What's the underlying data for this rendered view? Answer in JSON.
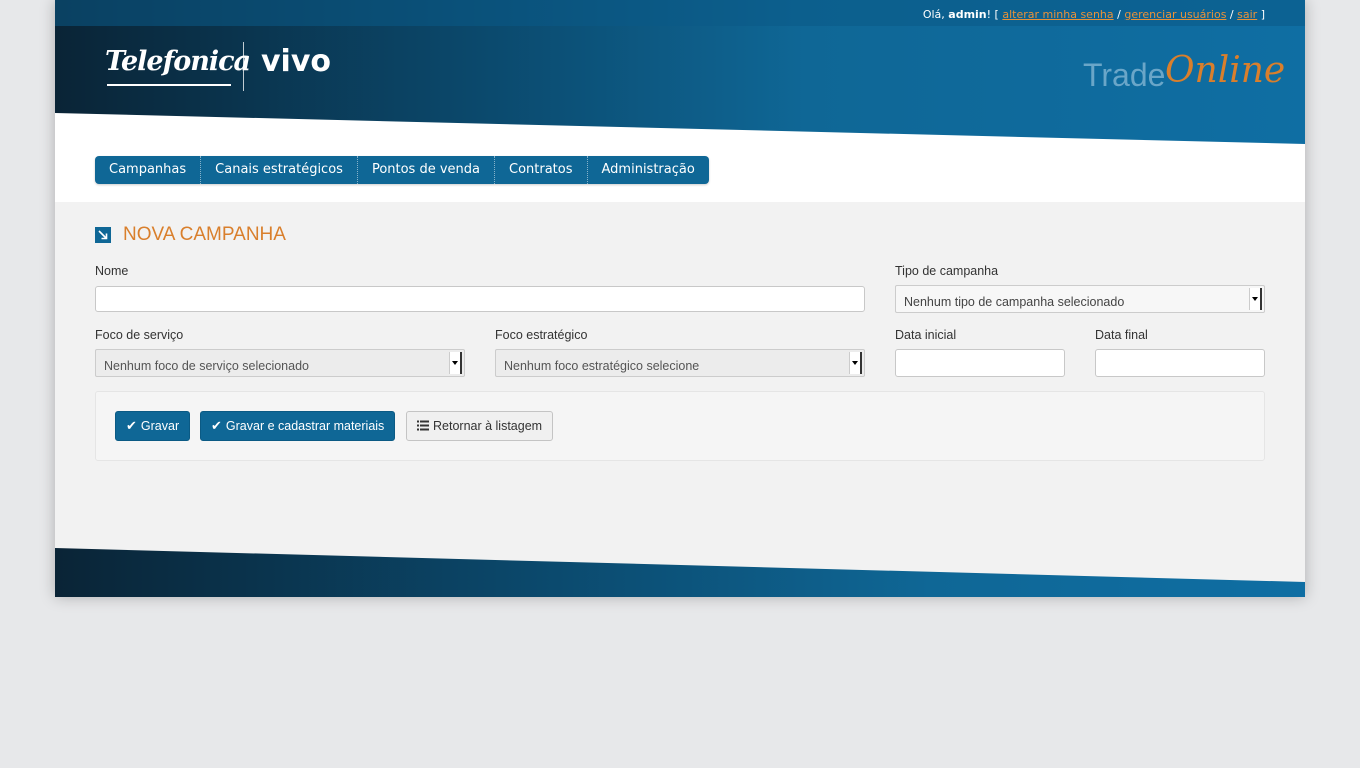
{
  "topbar": {
    "greeting": "Olá, ",
    "user": "admin",
    "exclaim": "! [ ",
    "link_password": "alterar minha senha",
    "sep1": " / ",
    "link_users": "gerenciar usuários",
    "sep2": " / ",
    "link_logout": "sair",
    "close": " ]"
  },
  "logos": {
    "telefonica": "Telefonica",
    "vivo": "vivo",
    "trade": "Trade",
    "online": "Online"
  },
  "nav": {
    "items": [
      {
        "label": "Campanhas"
      },
      {
        "label": "Canais estratégicos"
      },
      {
        "label": "Pontos de venda"
      },
      {
        "label": "Contratos"
      },
      {
        "label": "Administração"
      }
    ]
  },
  "form": {
    "title": "NOVA CAMPANHA",
    "nome_label": "Nome",
    "nome_value": "",
    "tipo_label": "Tipo de campanha",
    "tipo_value": "Nenhum tipo de campanha selecionado",
    "foco_servico_label": "Foco de serviço",
    "foco_servico_value": "Nenhum foco de serviço selecionado",
    "foco_estrategico_label": "Foco estratégico",
    "foco_estrategico_value": "Nenhum foco estratégico selecione",
    "data_inicial_label": "Data inicial",
    "data_inicial_value": "",
    "data_final_label": "Data final",
    "data_final_value": ""
  },
  "actions": {
    "gravar": "Gravar",
    "gravar_materiais": "Gravar e cadastrar materiais",
    "retornar": "Retornar à listagem"
  },
  "colors": {
    "brand_blue": "#0f6796",
    "accent_orange": "#d97f2c",
    "dark_navy": "#0a2a3d"
  }
}
